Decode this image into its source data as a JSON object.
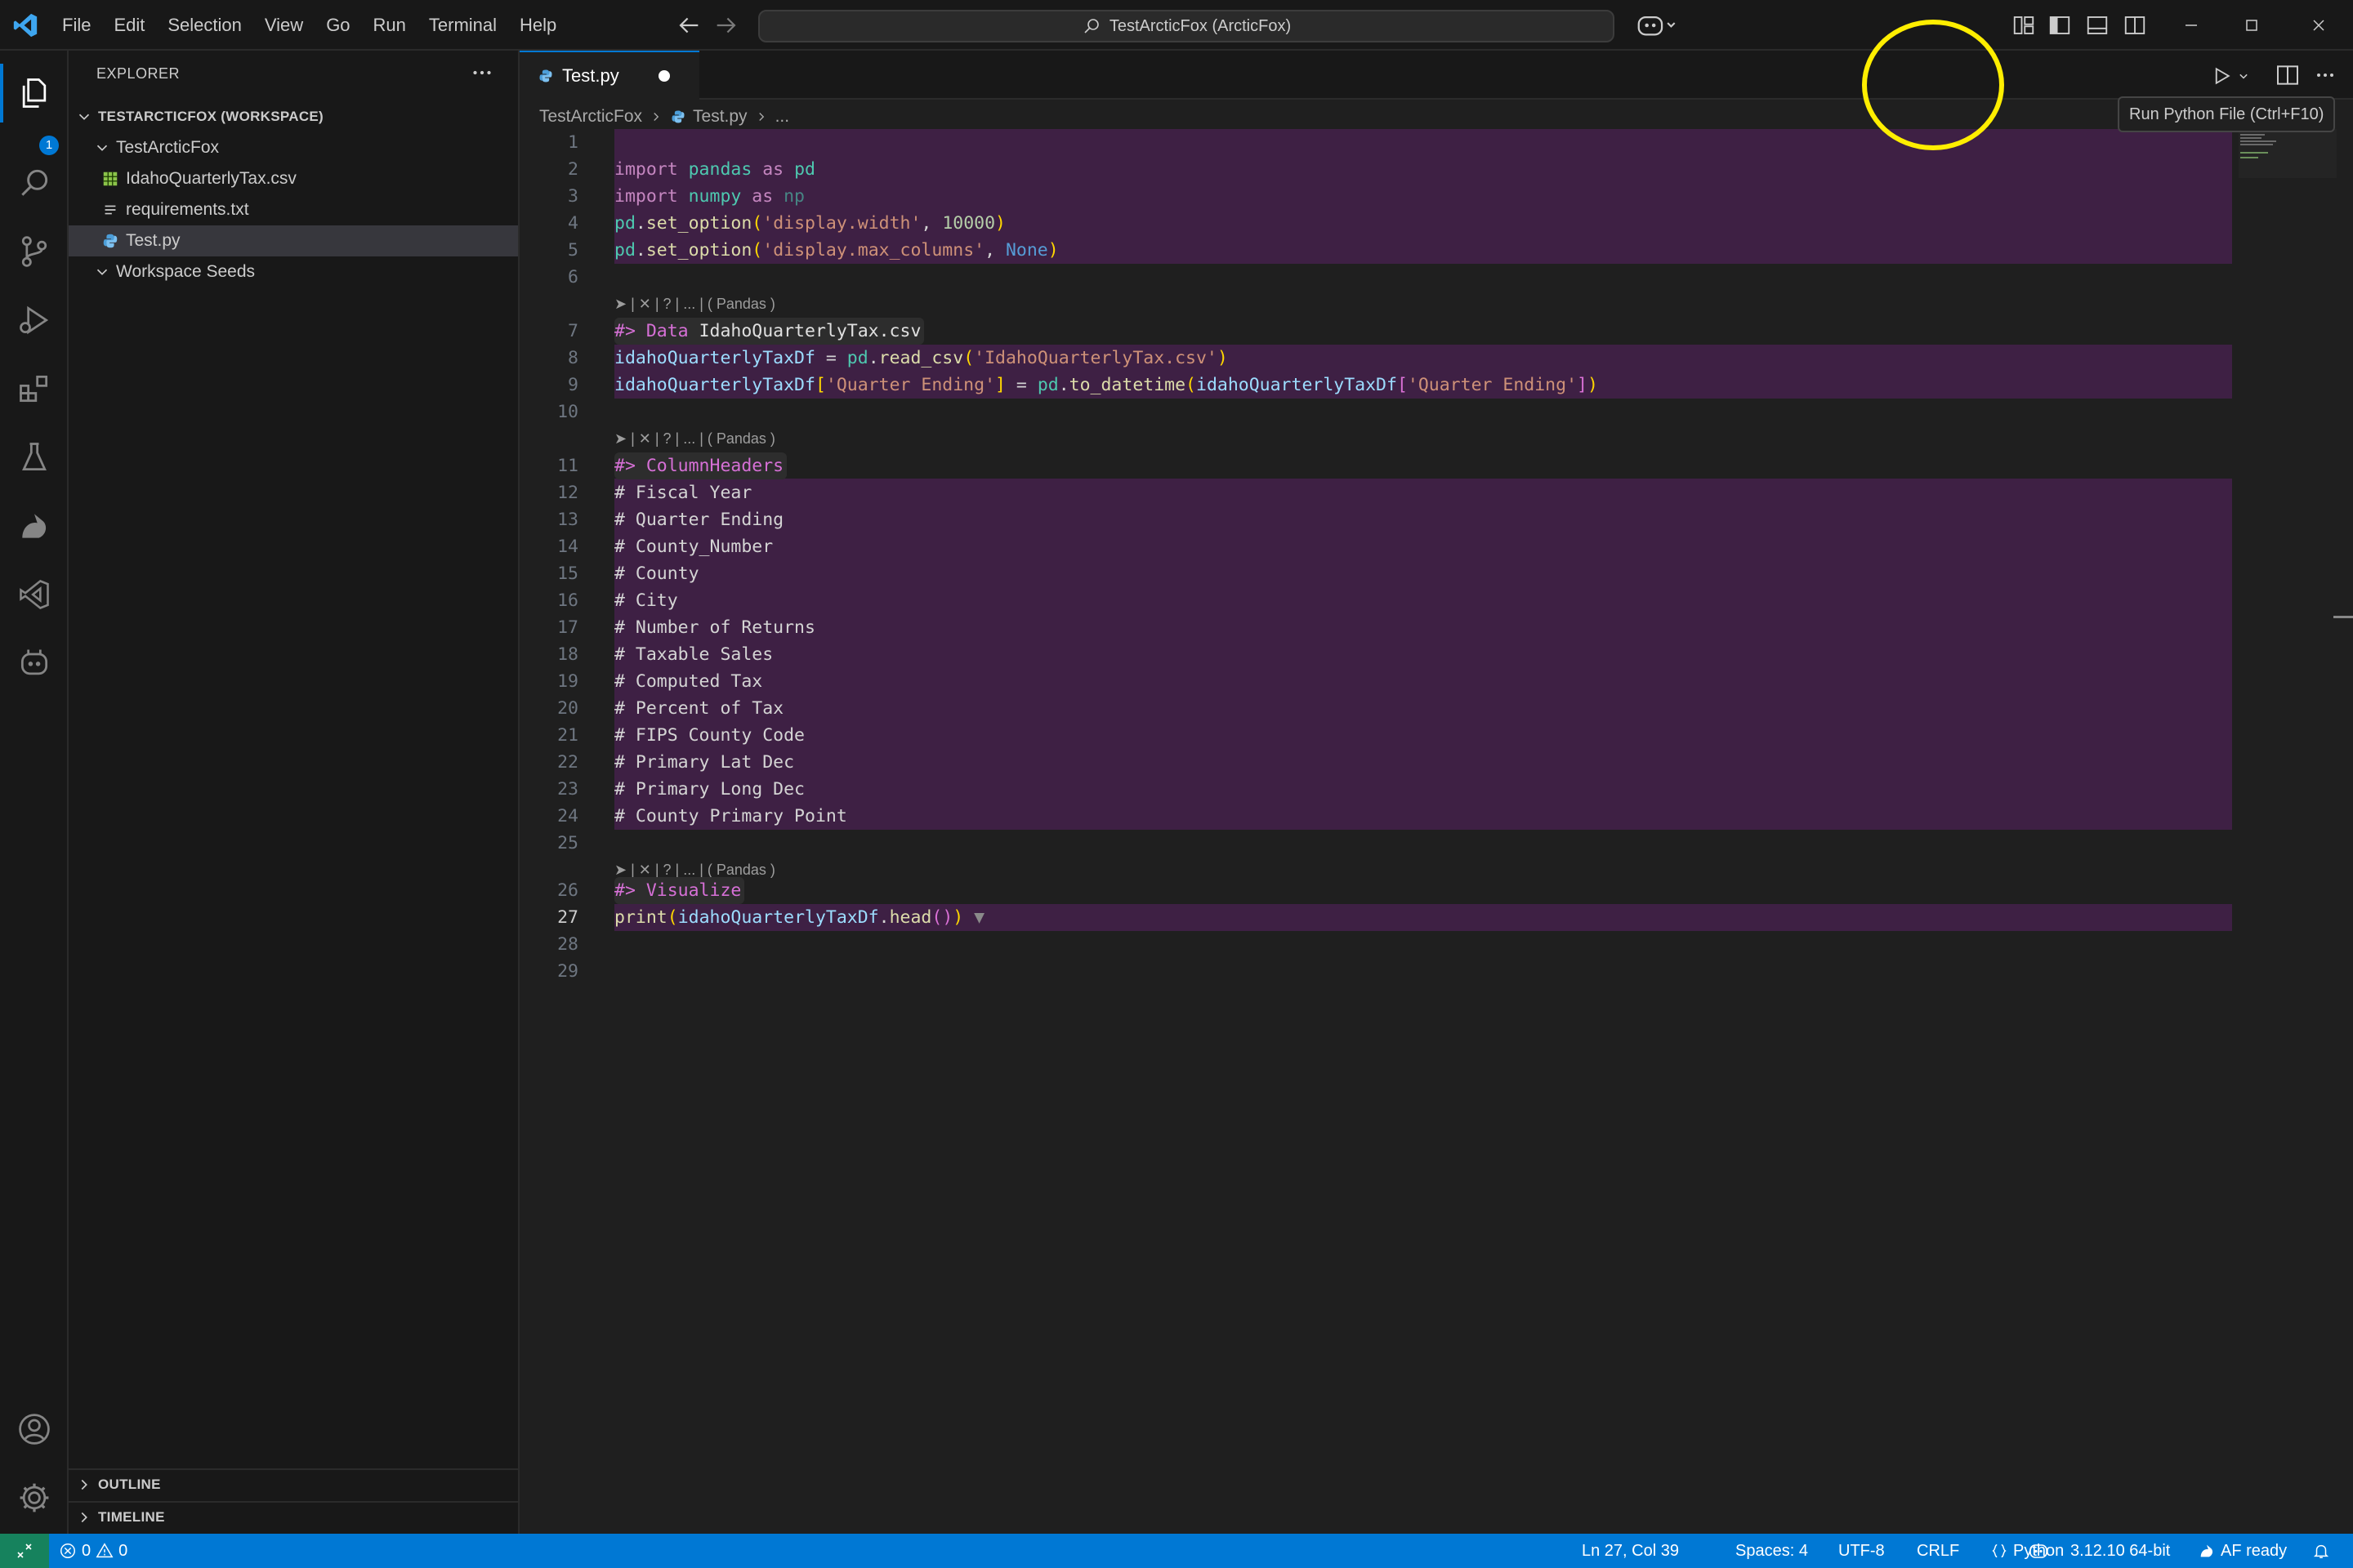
{
  "menu": [
    "File",
    "Edit",
    "Selection",
    "View",
    "Go",
    "Run",
    "Terminal",
    "Help"
  ],
  "command_center": {
    "text": "TestArcticFox (ArcticFox)"
  },
  "sidebar": {
    "header": "EXPLORER",
    "workspace": "TESTARCTICFOX (WORKSPACE)",
    "folder": "TestArcticFox",
    "files": [
      "IdahoQuarterlyTax.csv",
      "requirements.txt",
      "Test.py"
    ],
    "seeds": "Workspace Seeds",
    "outline": "OUTLINE",
    "timeline": "TIMELINE"
  },
  "activity": {
    "badge": "1"
  },
  "editor": {
    "tab": "Test.py",
    "tooltip": "Run Python File (Ctrl+F10)",
    "breadcrumb": [
      "TestArcticFox",
      "Test.py",
      "..."
    ],
    "lens": "➤ | ✕ | ? | ... | ( Pandas )",
    "cursor_line": 27
  },
  "code": {
    "l2": [
      "import",
      " pandas ",
      "as",
      " pd"
    ],
    "l3": [
      "import",
      " numpy ",
      "as",
      " np"
    ],
    "l4": [
      "pd",
      ".",
      "set_option",
      "(",
      "'display.width'",
      ", ",
      "10000",
      ")"
    ],
    "l5": [
      "pd",
      ".",
      "set_option",
      "(",
      "'display.max_columns'",
      ", ",
      "None",
      ")"
    ],
    "l7": [
      "#>",
      " Data ",
      "IdahoQuarterlyTax.csv"
    ],
    "l8": [
      "idahoQuarterlyTaxDf",
      " = ",
      "pd",
      ".",
      "read_csv",
      "(",
      "'IdahoQuarterlyTax.csv'",
      ")"
    ],
    "l9": [
      "idahoQuarterlyTaxDf",
      "[",
      "'Quarter Ending'",
      "]",
      " = ",
      "pd",
      ".",
      "to_datetime",
      "(",
      "idahoQuarterlyTaxDf",
      "[",
      "'Quarter Ending'",
      "]",
      ")"
    ],
    "l11": [
      "#>",
      " ColumnHeaders"
    ],
    "comments": [
      "# Fiscal Year",
      "# Quarter Ending",
      "# County_Number",
      "# County",
      "# City",
      "# Number of Returns",
      "# Taxable Sales",
      "# Computed Tax",
      "# Percent of Tax",
      "# FIPS County Code",
      "# Primary Lat Dec",
      "# Primary Long Dec",
      "# County Primary Point"
    ],
    "l26": [
      "#>",
      " Visualize"
    ],
    "l27": [
      "print",
      "(",
      "idahoQuarterlyTaxDf",
      ".",
      "head",
      "(",
      ")",
      ")",
      " ▼"
    ]
  },
  "status": {
    "errors": "0",
    "warnings": "0",
    "position": "Ln 27, Col 39",
    "spaces": "Spaces: 4",
    "encoding": "UTF-8",
    "eol": "CRLF",
    "language": "Python",
    "interpreter": "3.12.10 64-bit",
    "af": "AF ready"
  },
  "colors": {
    "accent": "#0078d4",
    "cell": "#3e2044",
    "highlight": "#ffee00"
  }
}
